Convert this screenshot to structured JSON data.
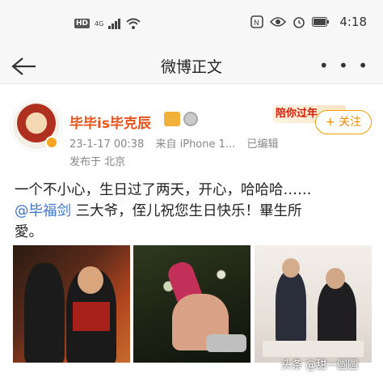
{
  "status_bar": {
    "hd": "HD",
    "network": "4G",
    "time": "4:18",
    "icons": [
      "hd-icon",
      "signal-icon",
      "wifi-icon",
      "nfc-icon",
      "eye-icon",
      "alarm-icon",
      "battery-icon"
    ]
  },
  "nav": {
    "title": "微博正文",
    "back_icon": "back-arrow-icon",
    "more_icon": "more-icon",
    "more_label": "• • •"
  },
  "post": {
    "username": "毕毕is毕克辰",
    "promo": "陪你过年",
    "follow_label": "+ 关注",
    "date": "23-1-17 00:38",
    "source": "来自 iPhone 1...",
    "edited": "已编辑",
    "location": "发布于 北京",
    "text_line1": "一个不小心，生日过了两天，开心，哈哈哈……",
    "mention": "@毕福剑",
    "text_line2_rest": " 三大爷，侄儿祝您生日快乐！畢生所",
    "text_line3": "愛。",
    "images": [
      "photo-two-men",
      "photo-hand-microphone",
      "photo-calligraphy"
    ]
  },
  "watermark": "头条 @甜一圆圆",
  "colors": {
    "username": "#e8541e",
    "mention": "#3b73c8",
    "follow": "#f08c00",
    "meta": "#888888"
  }
}
